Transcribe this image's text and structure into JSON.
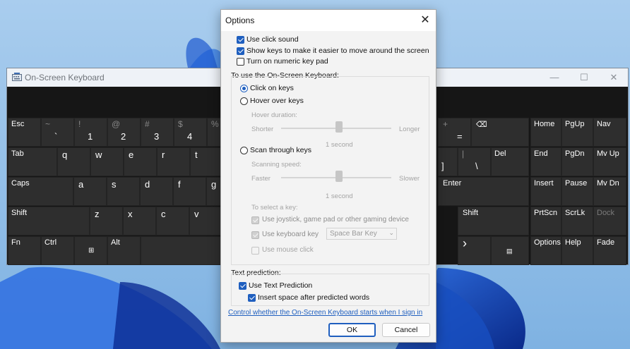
{
  "osk": {
    "title": "On-Screen Keyboard",
    "window_controls": {
      "minimize": "—",
      "maximize": "☐",
      "close": "✕"
    },
    "keys": {
      "esc": "Esc",
      "tilde_top": "~",
      "tilde_bot": "`",
      "n1_top": "!",
      "n1": "1",
      "n2_top": "@",
      "n2": "2",
      "n3_top": "#",
      "n3": "3",
      "n4_top": "$",
      "n4": "4",
      "n5_top": "%",
      "plus_top": "+",
      "equals": "=",
      "backspace": "⌫",
      "tab": "Tab",
      "q": "q",
      "w": "w",
      "e": "e",
      "r": "r",
      "t": "t",
      "pipe_top": "|",
      "backslash": "\\",
      "rbracket": "]",
      "del": "Del",
      "caps": "Caps",
      "a": "a",
      "s": "s",
      "d": "d",
      "f": "f",
      "g": "g",
      "enter": "Enter",
      "shift_l": "Shift",
      "z": "z",
      "x": "x",
      "c": "c",
      "v": "v",
      "shift_r": "Shift",
      "fn": "Fn",
      "ctrl": "Ctrl",
      "win": "⊞",
      "alt": "Alt",
      "right_arrow": "›",
      "menu": "▤",
      "home": "Home",
      "pgup": "PgUp",
      "nav": "Nav",
      "end": "End",
      "pgdn": "PgDn",
      "mvup": "Mv Up",
      "insert": "Insert",
      "pause": "Pause",
      "mvdn": "Mv Dn",
      "prtscn": "PrtScn",
      "scrlk": "ScrLk",
      "dock": "Dock",
      "options": "Options",
      "help": "Help",
      "fade": "Fade"
    }
  },
  "dialog": {
    "title": "Options",
    "close_glyph": "✕",
    "use_click_sound": {
      "label": "Use click sound",
      "checked": true
    },
    "show_keys": {
      "label": "Show keys to make it easier to move around the screen",
      "checked": true
    },
    "numeric_keypad": {
      "label": "Turn on numeric key pad",
      "checked": false
    },
    "use_osk_heading": "To use the On-Screen Keyboard:",
    "click_on_keys": {
      "label": "Click on keys",
      "selected": true
    },
    "hover_over_keys": {
      "label": "Hover over keys",
      "selected": false
    },
    "hover_duration": {
      "label": "Hover duration:",
      "min": "Shorter",
      "max": "Longer",
      "value": "1 second"
    },
    "scan_through_keys": {
      "label": "Scan through keys",
      "selected": false
    },
    "scanning_speed": {
      "label": "Scanning speed:",
      "min": "Faster",
      "max": "Slower",
      "value": "1 second"
    },
    "select_key_heading": "To select a key:",
    "use_joystick": {
      "label": "Use joystick, game pad or other gaming device",
      "checked": true
    },
    "use_keyboard_key": {
      "label": "Use keyboard key",
      "checked": true,
      "value": "Space Bar Key"
    },
    "use_mouse_click": {
      "label": "Use mouse click",
      "checked": false
    },
    "text_prediction_heading": "Text prediction:",
    "use_text_prediction": {
      "label": "Use Text Prediction",
      "checked": true
    },
    "insert_space": {
      "label": "Insert space after predicted words",
      "checked": true
    },
    "control_link": "Control whether the On-Screen Keyboard starts when I sign in",
    "ok": "OK",
    "cancel": "Cancel"
  },
  "colors": {
    "accent": "#1f5fbf",
    "key_bg": "#2e2e2e",
    "osk_bg": "#161616",
    "dialog_bg": "#f3f3f3"
  }
}
